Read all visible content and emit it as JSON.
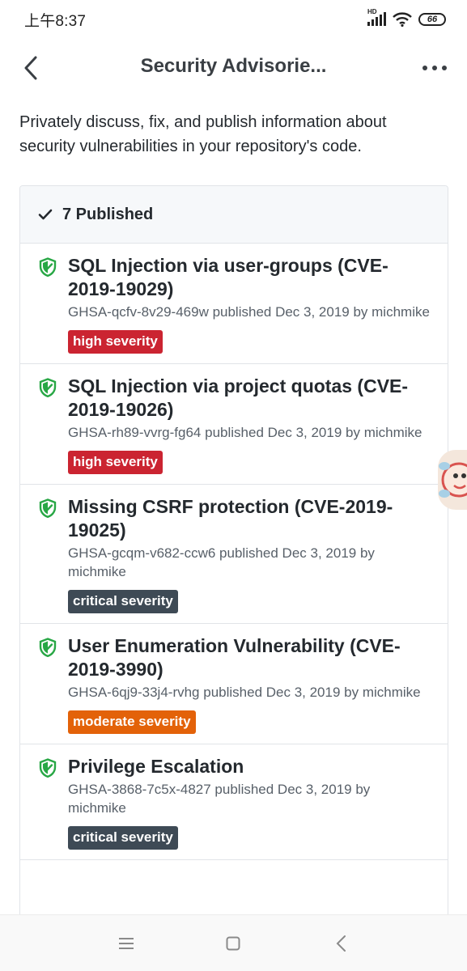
{
  "status_bar": {
    "time": "上午8:37",
    "network_label": "HD",
    "battery": "66"
  },
  "app_bar": {
    "title": "Security Advisorie..."
  },
  "intro": "Privately discuss, fix, and publish information about security vulnerabilities in your repository's code.",
  "list_header": {
    "label": "7 Published"
  },
  "advisories": [
    {
      "title": "SQL Injection via user-groups (CVE-2019-19029)",
      "meta": "GHSA-qcfv-8v29-469w published Dec 3, 2019 by michmike",
      "severity": "high severity",
      "severity_color": "#cb2431"
    },
    {
      "title": "SQL Injection via project quotas (CVE-2019-19026)",
      "meta": "GHSA-rh89-vvrg-fg64 published Dec 3, 2019 by michmike",
      "severity": "high severity",
      "severity_color": "#cb2431"
    },
    {
      "title": "Missing CSRF protection (CVE-2019-19025)",
      "meta": "GHSA-gcqm-v682-ccw6 published Dec 3, 2019 by michmike",
      "severity": "critical severity",
      "severity_color": "#3e4a55"
    },
    {
      "title": "User Enumeration Vulnerability (CVE-2019-3990)",
      "meta": "GHSA-6qj9-33j4-rvhg published Dec 3, 2019 by michmike",
      "severity": "moderate severity",
      "severity_color": "#e36209"
    },
    {
      "title": "Privilege Escalation",
      "meta": "GHSA-3868-7c5x-4827 published Dec 3, 2019 by michmike",
      "severity": "critical severity",
      "severity_color": "#3e4a55"
    }
  ],
  "colors": {
    "shield": "#28a745",
    "text": "#24292e",
    "muted": "#586069",
    "border": "#e1e4e8"
  },
  "icons": {
    "back": "chevron-left-icon",
    "more": "more-horizontal-icon",
    "check": "check-icon",
    "advisory": "shield-check-icon",
    "nav_menu": "menu-icon",
    "nav_home": "square-icon",
    "nav_back": "back-triangle-icon"
  }
}
